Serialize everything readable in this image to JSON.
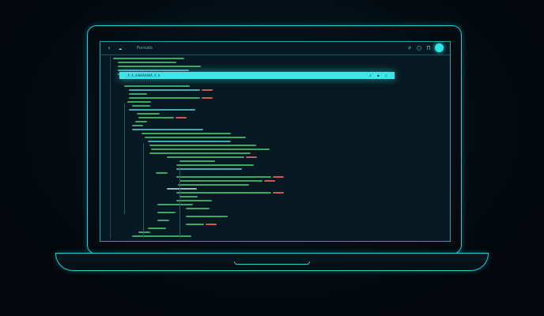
{
  "window": {
    "title": "Pursuits"
  },
  "toolbar": {
    "icons": [
      "back-icon",
      "cloud-icon",
      "search-icon",
      "document-icon",
      "lock-icon"
    ],
    "nav_glyph": "‹",
    "cloud_glyph": "☁",
    "search_glyph": "⌕",
    "doc_glyph": "▢",
    "lock_glyph": "⊓"
  },
  "find_bar": {
    "text": "_A_A_AAAAAAAAA_A_A",
    "controls": [
      "x",
      "●",
      "▢"
    ]
  },
  "colors": {
    "accent": "#2ee6e8",
    "code_green": "#4fd67a",
    "code_cyan": "#5fd8e0",
    "code_yellow": "#d8d86a",
    "code_red": "#e06060",
    "code_white": "#cfe8ee"
  }
}
